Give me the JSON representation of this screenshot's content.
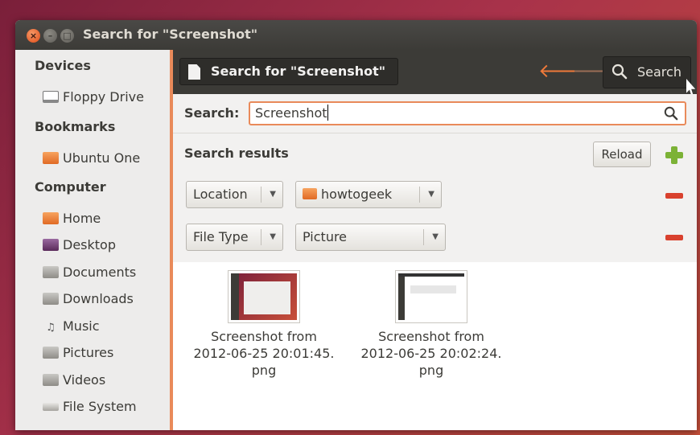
{
  "window": {
    "title": "Search for \"Screenshot\""
  },
  "sidebar": {
    "sections": [
      {
        "heading": "Devices",
        "items": [
          {
            "label": "Floppy Drive",
            "icon": "floppy-drive-icon"
          }
        ]
      },
      {
        "heading": "Bookmarks",
        "items": [
          {
            "label": "Ubuntu One",
            "icon": "ubuntu-one-folder-icon"
          }
        ]
      },
      {
        "heading": "Computer",
        "items": [
          {
            "label": "Home",
            "icon": "home-folder-icon"
          },
          {
            "label": "Desktop",
            "icon": "desktop-icon"
          },
          {
            "label": "Documents",
            "icon": "documents-folder-icon"
          },
          {
            "label": "Downloads",
            "icon": "downloads-folder-icon"
          },
          {
            "label": "Music",
            "icon": "music-folder-icon"
          },
          {
            "label": "Pictures",
            "icon": "pictures-folder-icon"
          },
          {
            "label": "Videos",
            "icon": "videos-folder-icon"
          },
          {
            "label": "File System",
            "icon": "file-system-icon"
          }
        ]
      }
    ]
  },
  "toolbar": {
    "path_label": "Search for \"Screenshot\"",
    "search_label": "Search"
  },
  "search": {
    "label": "Search:",
    "value": "Screenshot"
  },
  "results": {
    "title": "Search results",
    "reload_label": "Reload",
    "filters": [
      {
        "type": "Location",
        "value": "howtogeek"
      },
      {
        "type": "File Type",
        "value": "Picture"
      }
    ]
  },
  "files": [
    {
      "line1": "Screenshot from",
      "line2": "2012-06-25 20:01:45.",
      "line3": "png"
    },
    {
      "line1": "Screenshot from",
      "line2": "2012-06-25 20:02:24.",
      "line3": "png"
    }
  ],
  "colors": {
    "accent": "#e98a5a",
    "titlebar": "#3c3b37",
    "add": "#7cb236",
    "remove": "#d9412e"
  }
}
